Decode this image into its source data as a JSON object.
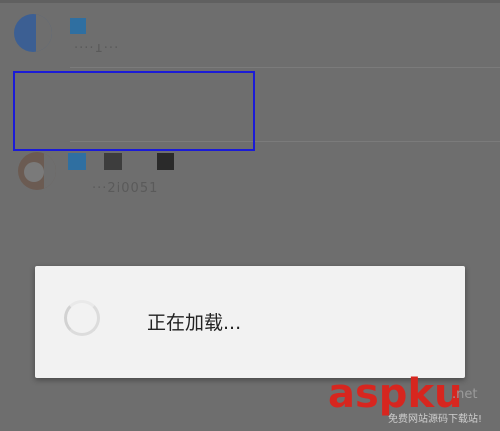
{
  "dialog": {
    "message": "正在加载..."
  },
  "list": {
    "rows": [
      {
        "subtext": "····1···"
      },
      {
        "subtext": "···2i0051"
      }
    ]
  },
  "watermark": {
    "brand_a": "asp",
    "brand_b": "ku",
    "suffix": ".net",
    "caption": "免费网站源码下载站!"
  },
  "colors": {
    "overlay": "#6e6e6e",
    "highlight": "#1b1bd6",
    "dialog_bg": "#f2f2f2",
    "brand_red": "#d7261f"
  }
}
